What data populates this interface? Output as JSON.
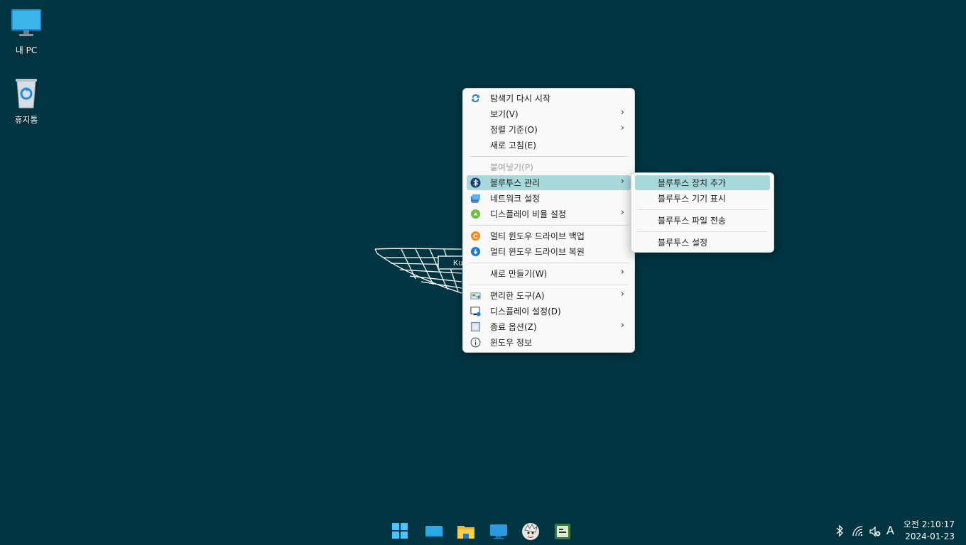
{
  "desktop": {
    "icons": [
      {
        "label": "내 PC",
        "icon": "monitor-icon"
      },
      {
        "label": "휴지통",
        "icon": "recycle-bin-icon"
      }
    ]
  },
  "context_menu": {
    "items": [
      {
        "label": "탐색기 다시 시작",
        "icon": "refresh-icon"
      },
      {
        "label": "보기(V)",
        "submenu": true
      },
      {
        "label": "정렬 기준(O)",
        "submenu": true
      },
      {
        "label": "새로 고침(E)"
      },
      {
        "label": "붙여넣기(P)",
        "disabled": true
      },
      {
        "label": "블루투스 관리",
        "icon": "bluetooth-icon",
        "submenu": true,
        "highlighted": true
      },
      {
        "label": "네트워크 설정",
        "icon": "network-icon"
      },
      {
        "label": "디스플레이 비율 설정",
        "icon": "display-scale-icon",
        "submenu": true
      },
      {
        "label": "멀티 윈도우 드라이브 백업",
        "icon": "backup-icon"
      },
      {
        "label": "멀티 윈도우 드라이브 복원",
        "icon": "restore-icon"
      },
      {
        "label": "새로 만들기(W)",
        "submenu": true
      },
      {
        "label": "편리한 도구(A)",
        "icon": "tools-icon",
        "submenu": true
      },
      {
        "label": "디스플레이 설정(D)",
        "icon": "display-settings-icon"
      },
      {
        "label": "종료 옵션(Z)",
        "icon": "shutdown-options-icon",
        "submenu": true
      },
      {
        "label": "윈도우 정보",
        "icon": "info-icon"
      }
    ],
    "arrow": "›"
  },
  "submenu": {
    "items": [
      {
        "label": "블루투스 장치 추가",
        "highlighted": true
      },
      {
        "label": "블루투스 기기 표시"
      },
      {
        "label": "블루투스 파일 전송"
      },
      {
        "label": "블루투스 설정"
      }
    ]
  },
  "wallpaper": {
    "logo_text": "Ku"
  },
  "taskbar": {
    "apps": [
      "start-icon",
      "desktop-icon",
      "file-explorer-icon",
      "remote-desktop-icon",
      "avatar-app-icon",
      "terminal-app-icon"
    ],
    "tray": {
      "ime_label": "A"
    },
    "clock": {
      "time": "오전 2:10:17",
      "date": "2024-01-23"
    }
  },
  "colors": {
    "background": "#003541",
    "highlight": "#a7d8db",
    "menu_bg": "#f9f9f9"
  }
}
